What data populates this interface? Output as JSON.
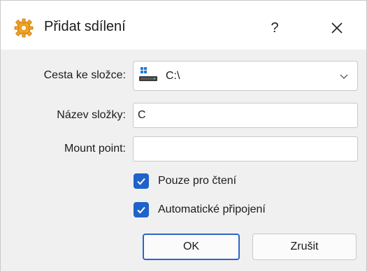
{
  "window": {
    "title": "Přidat sdílení",
    "help_label": "?",
    "title_icon": "gear-share-icon",
    "close_icon": "close-icon"
  },
  "form": {
    "folder_path_label": "Cesta ke složce:",
    "folder_path_value": "C:\\",
    "folder_name_label": "Název složky:",
    "folder_name_value": "C",
    "mount_point_label": "Mount point:",
    "mount_point_value": "",
    "readonly_label": "Pouze pro čtení",
    "readonly_checked": true,
    "automount_label": "Automatické připojení",
    "automount_checked": true
  },
  "buttons": {
    "ok_label": "OK",
    "cancel_label": "Zrušit"
  },
  "colors": {
    "accent": "#1f62c9",
    "titlebar": "#ffffff",
    "body": "#f0f0f0"
  }
}
